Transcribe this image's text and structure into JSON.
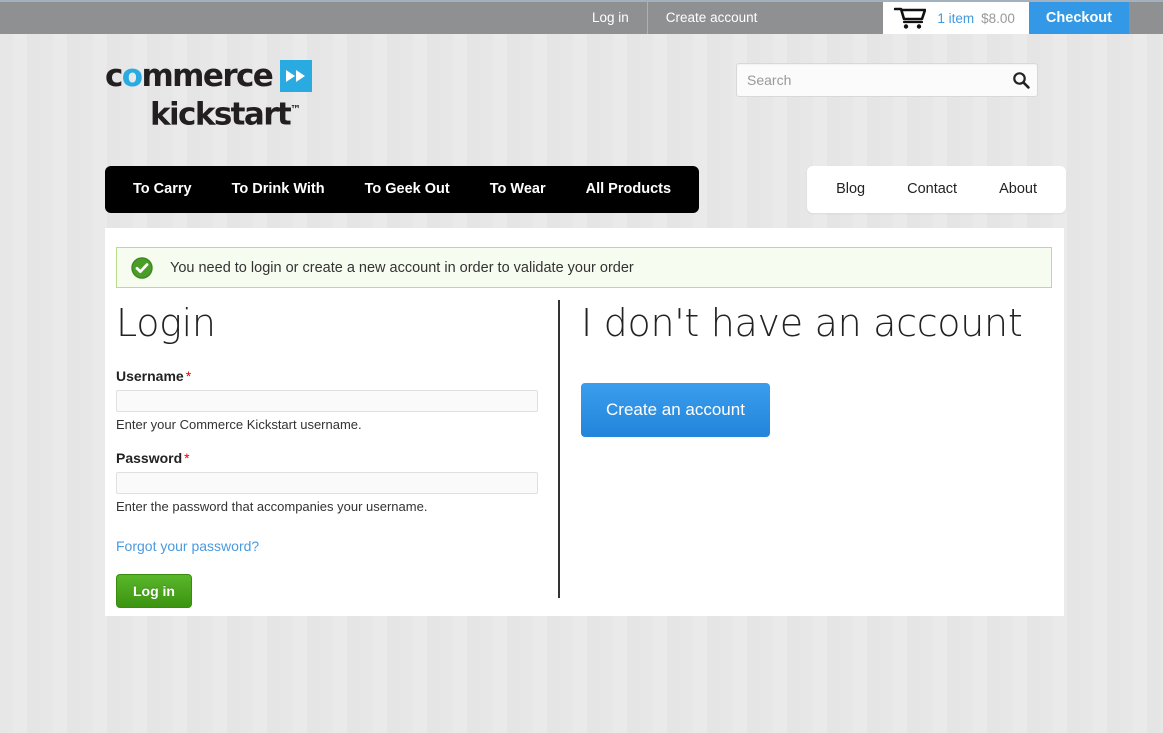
{
  "topbar": {
    "login_label": "Log in",
    "create_account_label": "Create account",
    "cart_icon": "shopping-cart-icon",
    "cart_count": "1 item",
    "cart_total": "$8.00",
    "checkout_label": "Checkout"
  },
  "header": {
    "logo": {
      "word1_pre": "c",
      "word1_o": "o",
      "word1_post": "mmerce",
      "word2": "kickstart",
      "tm": "™",
      "mark_icon": "fast-forward-icon"
    },
    "search": {
      "placeholder": "Search",
      "value": "",
      "icon": "search-icon"
    }
  },
  "main_nav": [
    {
      "label": "To Carry"
    },
    {
      "label": "To Drink With"
    },
    {
      "label": "To Geek Out"
    },
    {
      "label": "To Wear"
    },
    {
      "label": "All Products"
    }
  ],
  "sub_nav": [
    {
      "label": "Blog"
    },
    {
      "label": "Contact"
    },
    {
      "label": "About"
    }
  ],
  "status": {
    "icon": "check-circle-icon",
    "message": "You need to login or create a new account in order to validate your order"
  },
  "login": {
    "heading": "Login",
    "username": {
      "label": "Username",
      "required_marker": "*",
      "value": "",
      "description": "Enter your Commerce Kickstart username."
    },
    "password": {
      "label": "Password",
      "required_marker": "*",
      "value": "",
      "description": "Enter the password that accompanies your username."
    },
    "forgot_link": "Forgot your password?",
    "submit_label": "Log in"
  },
  "register": {
    "heading": "I don't have an account",
    "button_label": "Create an account"
  },
  "colors": {
    "topbar_bg": "#8e9092",
    "accent_blue": "#3399e6",
    "logo_blue": "#29abe2",
    "success_green": "#4a9e28",
    "link_blue": "#4a9ae0",
    "page_bg": "#e8e8e8"
  }
}
